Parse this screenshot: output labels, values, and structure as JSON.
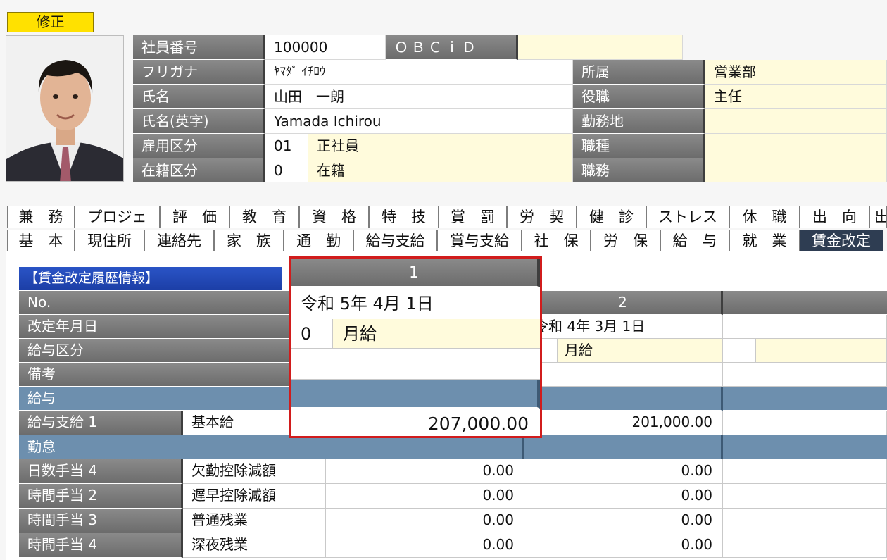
{
  "edit_button": "修正",
  "employee": {
    "labels": {
      "number": "社員番号",
      "obcid": "ＯＢＣｉＤ",
      "kana": "フリガナ",
      "name": "氏名",
      "name_en": "氏名(英字)",
      "employment": "雇用区分",
      "status": "在籍区分",
      "department": "所属",
      "position": "役職",
      "workplace": "勤務地",
      "job_type": "職種",
      "duty": "職務"
    },
    "values": {
      "number": "100000",
      "obcid": "",
      "kana": "ﾔﾏﾀﾞ ｲﾁﾛｳ",
      "name": "山田　一朗",
      "name_en": "Yamada Ichirou",
      "employment_code": "01",
      "employment": "正社員",
      "status_code": "0",
      "status": "在籍",
      "department": "営業部",
      "position": "主任",
      "workplace": "",
      "job_type": "",
      "duty": ""
    }
  },
  "tabs_row1": [
    "兼　務",
    "プロジェ",
    "評　価",
    "教　育",
    "資　格",
    "特　技",
    "賞　罰",
    "労　契",
    "健　診",
    "ストレス",
    "休　職",
    "出　向",
    "出"
  ],
  "tabs_row2": [
    "基　本",
    "現住所",
    "連絡先",
    "家　族",
    "通　勤",
    "給与支給",
    "賞与支給",
    "社　保",
    "労　保",
    "給　与",
    "就　業",
    "賃金改定"
  ],
  "active_tab": "賃金改定",
  "section_title": "【賃金改定履歴情報】",
  "rows": {
    "no": "No.",
    "date": "改定年月日",
    "pay_type": "給与区分",
    "note": "備考",
    "salary_section": "給与",
    "salary1": "給与支給 1",
    "salary1_item": "基本給",
    "attendance_section": "勤怠",
    "items": [
      {
        "label": "日数手当 4",
        "name": "欠勤控除減額",
        "v1": "0.00",
        "v2": "0.00"
      },
      {
        "label": "時間手当 2",
        "name": "遅早控除減額",
        "v1": "0.00",
        "v2": "0.00"
      },
      {
        "label": "時間手当 3",
        "name": "普通残業",
        "v1": "0.00",
        "v2": "0.00"
      },
      {
        "label": "時間手当 4",
        "name": "深夜残業",
        "v1": "0.00",
        "v2": "0.00"
      }
    ]
  },
  "col2": {
    "no": "2",
    "date": "令和  4年  3月  1日",
    "pay_type": "月給",
    "salary1": "201,000.00"
  },
  "zoom": {
    "no": "1",
    "date": "令和  5年  4月  1日",
    "pay_code": "0",
    "pay_type": "月給",
    "salary1": "207,000.00"
  }
}
